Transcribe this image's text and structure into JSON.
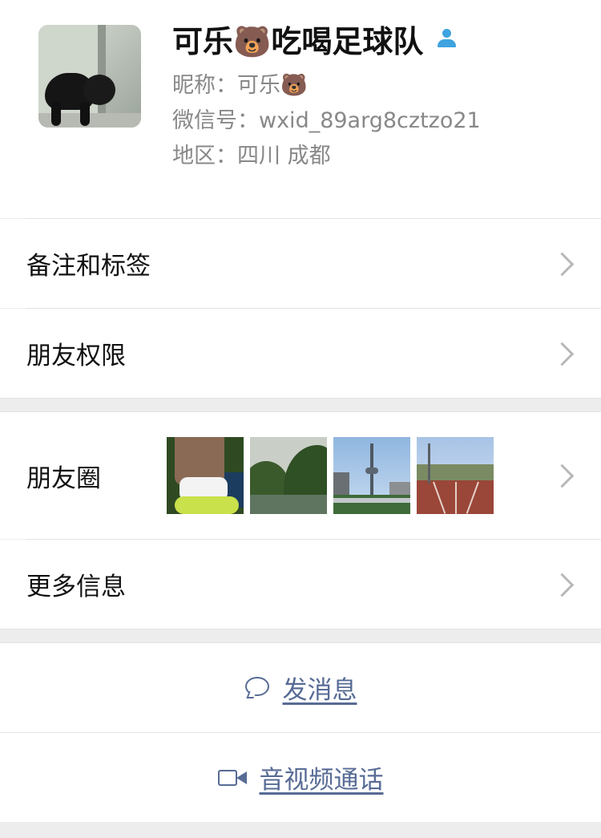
{
  "profile": {
    "display_name": "可乐🐻吃喝足球队",
    "nickname_label": "昵称：",
    "nickname_value": "可乐🐻",
    "wechat_id_label": "微信号：",
    "wechat_id_value": "wxid_89arg8cztzo21",
    "region_label": "地区：",
    "region_value": "四川 成都",
    "badge_icon": "person-icon",
    "badge_color": "#3fa3e0"
  },
  "rows": {
    "remarks_tags": "备注和标签",
    "friend_permissions": "朋友权限",
    "moments": "朋友圈",
    "more_info": "更多信息"
  },
  "moments_thumbnails": [
    "leg-and-sock-photo",
    "river-valley-photo",
    "city-tower-photo",
    "running-track-photo"
  ],
  "actions": {
    "send_message": "发消息",
    "send_message_icon": "chat-bubble-icon",
    "video_call": "音视频通话",
    "video_call_icon": "video-camera-icon",
    "link_color": "#576b95"
  }
}
